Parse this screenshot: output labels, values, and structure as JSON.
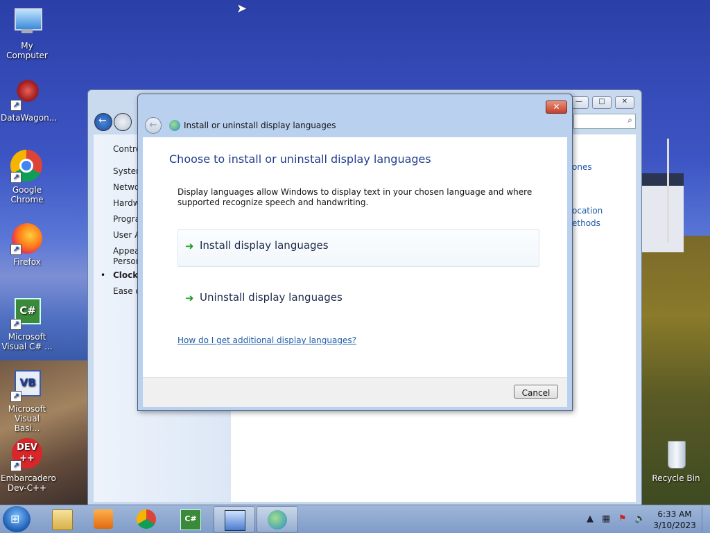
{
  "desktop": {
    "icons": [
      {
        "label": "My Computer",
        "icon": "computer-icon"
      },
      {
        "label": "DataWagon...",
        "icon": "datawagon-icon"
      },
      {
        "label": "Google Chrome",
        "icon": "chrome-icon"
      },
      {
        "label": "Firefox",
        "icon": "firefox-icon"
      },
      {
        "label": "Microsoft Visual C# ...",
        "icon": "visual-csharp-icon"
      },
      {
        "label": "Microsoft Visual Basi...",
        "icon": "visual-basic-icon"
      },
      {
        "label": "Embarcadero Dev-C++",
        "icon": "devcpp-icon"
      },
      {
        "label": "Recycle Bin",
        "icon": "recycle-bin-icon"
      }
    ]
  },
  "control_panel": {
    "sidebar": [
      "Contro",
      "System",
      "Netwo",
      "Hardw",
      "Progra",
      "User Ac",
      "Appear",
      "Person",
      "Clock,",
      "Ease of"
    ],
    "right_links": [
      "ones",
      "ocation",
      "ethods"
    ],
    "window_buttons": {
      "minimize": "—",
      "maximize": "□",
      "close": "✕"
    }
  },
  "dialog": {
    "title": "Install or uninstall display languages",
    "heading": "Choose to install or uninstall display languages",
    "description": "Display languages allow Windows to display text in your chosen language and where supported recognize speech and handwriting.",
    "commands": [
      {
        "label": "Install display languages"
      },
      {
        "label": "Uninstall display languages"
      }
    ],
    "help_link": "How do I get additional display languages?",
    "cancel": "Cancel",
    "close_glyph": "✕"
  },
  "taskbar": {
    "buttons": [
      "file-explorer-icon",
      "media-player-icon",
      "chrome-icon",
      "visual-csharp-icon",
      "control-panel-icon",
      "language-settings-icon"
    ],
    "clock": {
      "time": "6:33 AM",
      "date": "3/10/2023"
    }
  }
}
